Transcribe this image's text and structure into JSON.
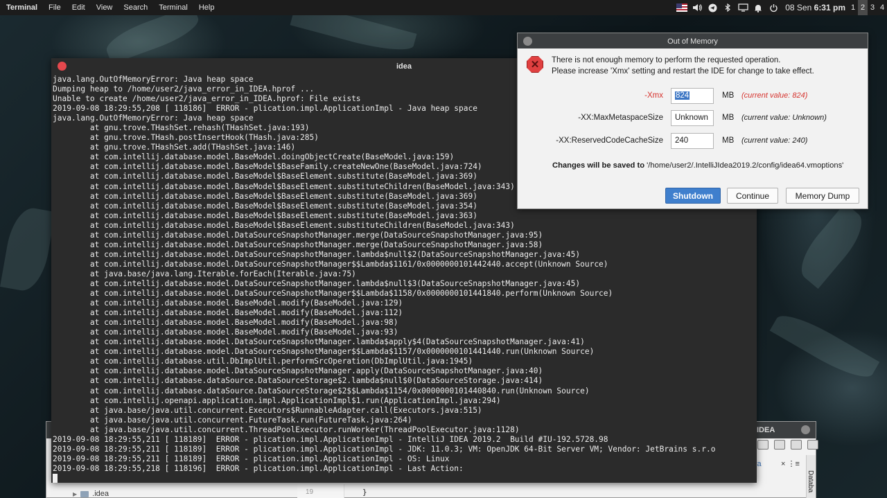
{
  "top_panel": {
    "app_name": "Terminal",
    "menu": [
      "File",
      "Edit",
      "View",
      "Search",
      "Terminal",
      "Help"
    ],
    "clock_date": "08 Sen",
    "clock_time": "6:31 pm",
    "workspaces": [
      "1",
      "2",
      "3",
      "4"
    ],
    "active_workspace": "2",
    "tray_icons": [
      "us-flag-icon",
      "volume-icon",
      "telegram-icon",
      "bluetooth-icon",
      "display-icon",
      "notification-bell-icon",
      "power-icon"
    ]
  },
  "ide": {
    "title_fragment": "IDEA",
    "tab_fragment": "va",
    "tab_control": "× ⋮≡",
    "side_label": "Databa",
    "line_number": "19",
    "code_line": "}",
    "tree_item": ".idea"
  },
  "terminal": {
    "title": "idea",
    "lines": [
      "java.lang.OutOfMemoryError: Java heap space",
      "Dumping heap to /home/user2/java_error_in_IDEA.hprof ...",
      "Unable to create /home/user2/java_error_in_IDEA.hprof: File exists",
      "2019-09-08 18:29:55,208 [ 118186]  ERROR - plication.impl.ApplicationImpl - Java heap space",
      "java.lang.OutOfMemoryError: Java heap space",
      "\tat gnu.trove.THashSet.rehash(THashSet.java:193)",
      "\tat gnu.trove.THash.postInsertHook(THash.java:285)",
      "\tat gnu.trove.THashSet.add(THashSet.java:146)",
      "\tat com.intellij.database.model.BaseModel.doingObjectCreate(BaseModel.java:159)",
      "\tat com.intellij.database.model.BaseModel$BaseFamily.createNewOne(BaseModel.java:724)",
      "\tat com.intellij.database.model.BaseModel$BaseElement.substitute(BaseModel.java:369)",
      "\tat com.intellij.database.model.BaseModel$BaseElement.substituteChildren(BaseModel.java:343)",
      "\tat com.intellij.database.model.BaseModel$BaseElement.substitute(BaseModel.java:369)",
      "\tat com.intellij.database.model.BaseModel$BaseElement.substitute(BaseModel.java:354)",
      "\tat com.intellij.database.model.BaseModel$BaseElement.substitute(BaseModel.java:363)",
      "\tat com.intellij.database.model.BaseModel$BaseElement.substituteChildren(BaseModel.java:343)",
      "\tat com.intellij.database.model.DataSourceSnapshotManager.merge(DataSourceSnapshotManager.java:95)",
      "\tat com.intellij.database.model.DataSourceSnapshotManager.merge(DataSourceSnapshotManager.java:58)",
      "\tat com.intellij.database.model.DataSourceSnapshotManager.lambda$null$2(DataSourceSnapshotManager.java:45)",
      "\tat com.intellij.database.model.DataSourceSnapshotManager$$Lambda$1161/0x0000000101442440.accept(Unknown Source)",
      "\tat java.base/java.lang.Iterable.forEach(Iterable.java:75)",
      "\tat com.intellij.database.model.DataSourceSnapshotManager.lambda$null$3(DataSourceSnapshotManager.java:45)",
      "\tat com.intellij.database.model.DataSourceSnapshotManager$$Lambda$1158/0x0000000101441840.perform(Unknown Source)",
      "\tat com.intellij.database.model.BaseModel.modify(BaseModel.java:129)",
      "\tat com.intellij.database.model.BaseModel.modify(BaseModel.java:112)",
      "\tat com.intellij.database.model.BaseModel.modify(BaseModel.java:98)",
      "\tat com.intellij.database.model.BaseModel.modify(BaseModel.java:93)",
      "\tat com.intellij.database.model.DataSourceSnapshotManager.lambda$apply$4(DataSourceSnapshotManager.java:41)",
      "\tat com.intellij.database.model.DataSourceSnapshotManager$$Lambda$1157/0x0000000101441440.run(Unknown Source)",
      "\tat com.intellij.database.util.DbImplUtil.performSrcOperation(DbImplUtil.java:1945)",
      "\tat com.intellij.database.model.DataSourceSnapshotManager.apply(DataSourceSnapshotManager.java:40)",
      "\tat com.intellij.database.dataSource.DataSourceStorage$2.lambda$null$0(DataSourceStorage.java:414)",
      "\tat com.intellij.database.dataSource.DataSourceStorage$2$$Lambda$1154/0x0000000101440840.run(Unknown Source)",
      "\tat com.intellij.openapi.application.impl.ApplicationImpl$1.run(ApplicationImpl.java:294)",
      "\tat java.base/java.util.concurrent.Executors$RunnableAdapter.call(Executors.java:515)",
      "\tat java.base/java.util.concurrent.FutureTask.run(FutureTask.java:264)",
      "\tat java.base/java.util.concurrent.ThreadPoolExecutor.runWorker(ThreadPoolExecutor.java:1128)",
      "2019-09-08 18:29:55,211 [ 118189]  ERROR - plication.impl.ApplicationImpl - IntelliJ IDEA 2019.2  Build #IU-192.5728.98",
      "2019-09-08 18:29:55,211 [ 118189]  ERROR - plication.impl.ApplicationImpl - JDK: 11.0.3; VM: OpenJDK 64-Bit Server VM; Vendor: JetBrains s.r.o",
      "2019-09-08 18:29:55,211 [ 118189]  ERROR - plication.impl.ApplicationImpl - OS: Linux",
      "2019-09-08 18:29:55,218 [ 118196]  ERROR - plication.impl.ApplicationImpl - Last Action:"
    ]
  },
  "dialog": {
    "title": "Out of Memory",
    "message_line1": "There is not enough memory to perform the requested operation.",
    "message_line2": "Please increase 'Xmx' setting and restart the IDE for change to take effect.",
    "options": [
      {
        "label": "-Xmx",
        "value": "824",
        "unit": "MB",
        "current": "(current value: 824)"
      },
      {
        "label": "-XX:MaxMetaspaceSize",
        "value": "Unknown",
        "unit": "MB",
        "current": "(current value: Unknown)"
      },
      {
        "label": "-XX:ReservedCodeCacheSize",
        "value": "240",
        "unit": "MB",
        "current": "(current value: 240)"
      }
    ],
    "save_note_bold": "Changes will be saved to",
    "save_note_path": " '/home/user2/.IntelliJIdea2019.2/config/idea64.vmoptions'",
    "buttons": {
      "shutdown": "Shutdown",
      "continue": "Continue",
      "memory_dump": "Memory Dump"
    },
    "accent_color": "#3f7fcd",
    "error_color": "#d6332e"
  }
}
